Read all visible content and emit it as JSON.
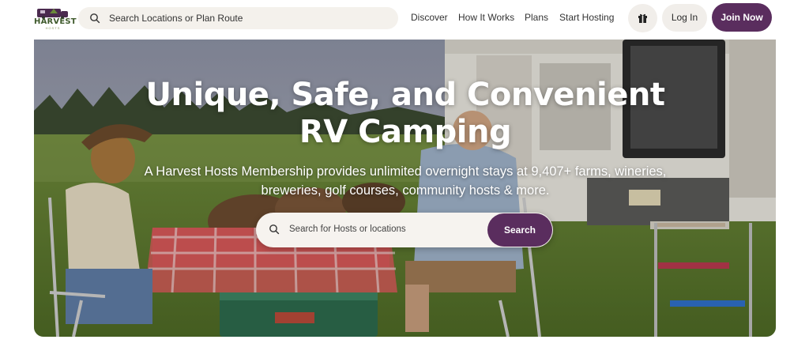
{
  "brand": {
    "logo_text": "HARVEST",
    "logo_subtext": "HOSTS",
    "primary_color": "#5a2d5e",
    "logo_green": "#3f5a2c"
  },
  "header": {
    "search": {
      "placeholder": "Search Locations or Plan Route",
      "icon": "search-icon"
    },
    "nav": [
      {
        "label": "Discover"
      },
      {
        "label": "How It Works"
      },
      {
        "label": "Plans"
      },
      {
        "label": "Start Hosting"
      }
    ],
    "gift_icon": "gift-icon",
    "login_label": "Log In",
    "join_label": "Join Now"
  },
  "hero": {
    "title": "Unique, Safe, and Convenient RV Camping",
    "subtitle": "A Harvest Hosts Membership provides unlimited overnight stays at 9,407+ farms, wineries, breweries, golf courses, community hosts & more.",
    "search": {
      "placeholder": "Search for Hosts or locations",
      "button_label": "Search",
      "icon": "search-icon"
    }
  }
}
